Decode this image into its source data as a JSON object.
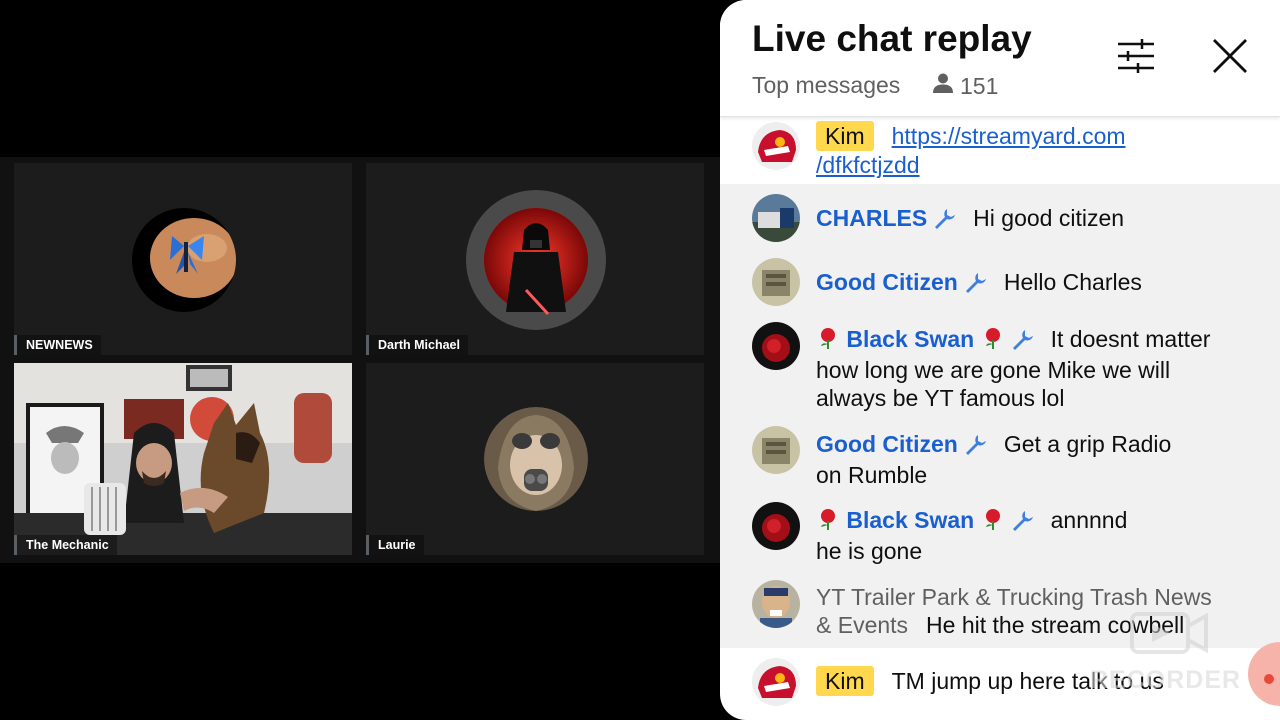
{
  "participants": [
    {
      "name": "NEWNEWS"
    },
    {
      "name": "Darth Michael"
    },
    {
      "name": "The Mechanic"
    },
    {
      "name": "Laurie"
    }
  ],
  "chat": {
    "title": "Live chat replay",
    "filter_label": "Top messages",
    "viewer_count": "151",
    "messages": [
      {
        "author": "Kim",
        "text": "https://streamyard.com/dfkfctjzdd",
        "link_line1": "https://streamyard.com",
        "link_line2": "/dfkfctjzdd"
      },
      {
        "author": "CHARLES",
        "text": "Hi good citizen"
      },
      {
        "author": "Good Citizen",
        "text": "Hello Charles"
      },
      {
        "author": "Black Swan",
        "text_line1": "It doesnt matter",
        "text_line2": "how long we are gone Mike we will",
        "text_line3": "always be YT famous lol"
      },
      {
        "author": "Good Citizen",
        "text_line1": "Get a grip Radio",
        "text_line2": "on Rumble"
      },
      {
        "author": "Black Swan",
        "text_line1": "annnnd",
        "text_line2": "he is gone"
      },
      {
        "author_line1": "YT Trailer Park & Trucking Trash News",
        "author_line2": "& Events",
        "text": "He hit the stream cowbell"
      },
      {
        "author": "Kim",
        "text": "TM jump up here talk to us"
      }
    ]
  },
  "watermark": "RECORDER",
  "colors": {
    "author_blue": "#1a5fd0",
    "kim_badge": "#ffd84d",
    "pinned_bg": "#f1f1f1"
  }
}
